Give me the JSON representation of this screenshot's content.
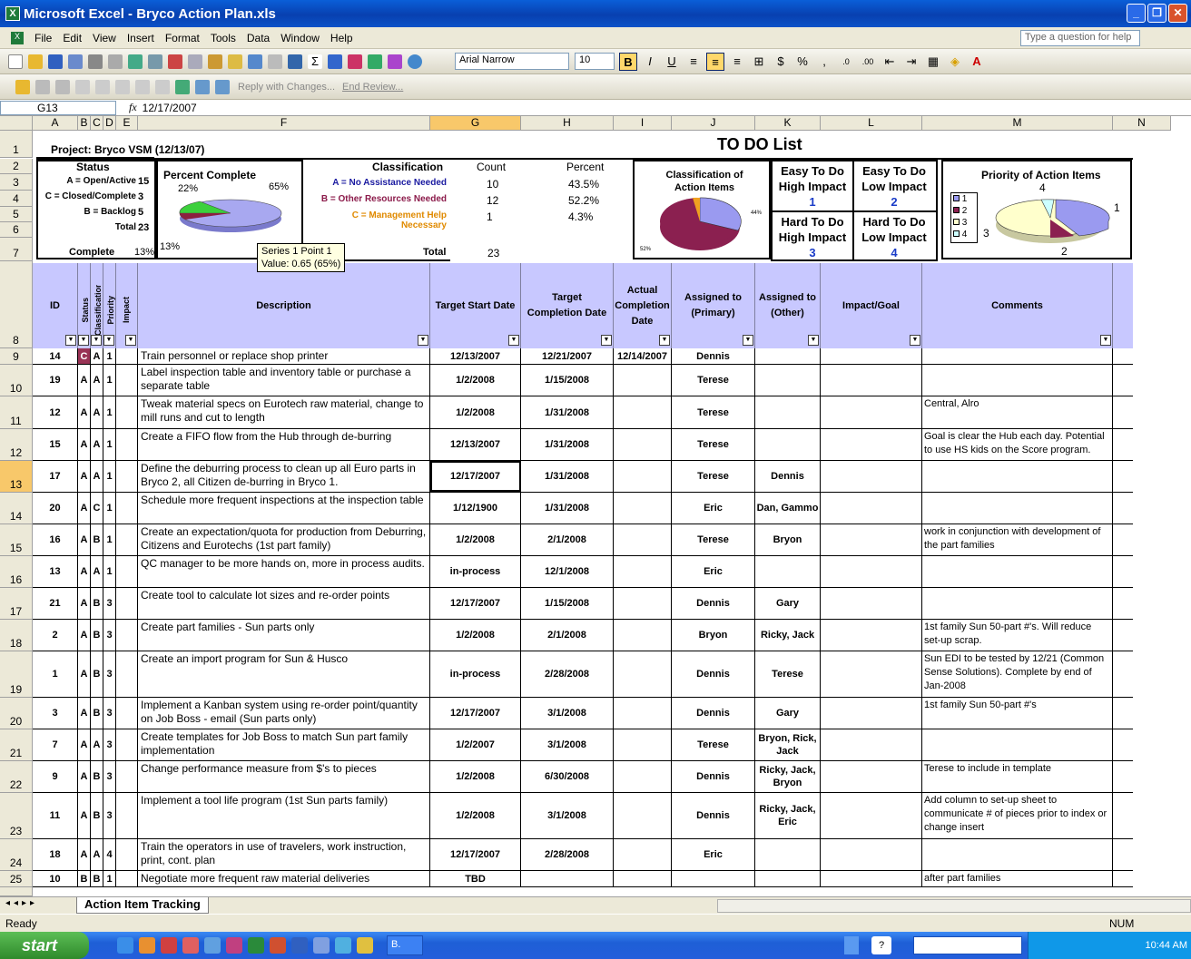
{
  "window": {
    "title": "Microsoft Excel - Bryco Action Plan.xls"
  },
  "menu": [
    "File",
    "Edit",
    "View",
    "Insert",
    "Format",
    "Tools",
    "Data",
    "Window",
    "Help"
  ],
  "help_placeholder": "Type a question for help",
  "toolbar": {
    "font": "Arial Narrow",
    "size": "10",
    "reply": "Reply with Changes...",
    "end_review": "End Review..."
  },
  "formula": {
    "cell": "G13",
    "value": "12/17/2007"
  },
  "columns": [
    {
      "letter": "A",
      "w": 50
    },
    {
      "letter": "B",
      "w": 14
    },
    {
      "letter": "C",
      "w": 14
    },
    {
      "letter": "D",
      "w": 14
    },
    {
      "letter": "E",
      "w": 24
    },
    {
      "letter": "F",
      "w": 322
    },
    {
      "letter": "G",
      "w": 100
    },
    {
      "letter": "H",
      "w": 102
    },
    {
      "letter": "I",
      "w": 64
    },
    {
      "letter": "J",
      "w": 92
    },
    {
      "letter": "K",
      "w": 72
    },
    {
      "letter": "L",
      "w": 112
    },
    {
      "letter": "M",
      "w": 210
    },
    {
      "letter": "N",
      "w": 64
    }
  ],
  "sheet": {
    "project": "Project:  Bryco VSM (12/13/07)",
    "todo": "TO DO List",
    "status_label": "Status",
    "status": [
      {
        "label": "A = Open/Active",
        "value": "15"
      },
      {
        "label": "C = Closed/Complete",
        "value": "3"
      },
      {
        "label": "B = Backlog",
        "value": "5"
      },
      {
        "label": "Total",
        "value": "23"
      }
    ],
    "complete_label": "Complete",
    "complete_value": "13%",
    "pc_chart": {
      "title": "Percent Complete",
      "lbl_a": "22%",
      "lbl_b": "65%",
      "lbl_c": "13%"
    },
    "classification_label": "Classification",
    "count_label": "Count",
    "percent_label": "Percent",
    "classes": [
      {
        "label": "A = No Assistance Needed",
        "count": "10",
        "percent": "43.5%",
        "color": "#1a1aa0"
      },
      {
        "label": "B = Other Resources Needed",
        "count": "12",
        "percent": "52.2%",
        "color": "#8b1a4a"
      },
      {
        "label": "C = Management Help Necessary",
        "count": "1",
        "percent": "4.3%",
        "color": "#e08a00"
      }
    ],
    "total_label": "Total",
    "total_value": "23",
    "class_chart": {
      "title": "Classification of Action Items",
      "lbl_a": "44%",
      "lbl_b": "52%"
    },
    "impact": [
      {
        "l1": "Easy To Do",
        "l2": "High Impact",
        "n": "1"
      },
      {
        "l1": "Easy To Do",
        "l2": "Low Impact",
        "n": "2"
      },
      {
        "l1": "Hard To Do",
        "l2": "High Impact",
        "n": "3"
      },
      {
        "l1": "Hard To Do",
        "l2": "Low Impact",
        "n": "4"
      }
    ],
    "priority_chart": {
      "title": "Priority of Action Items",
      "legend": [
        "1",
        "2",
        "3",
        "4"
      ],
      "labels": {
        "p1": "1",
        "p2": "2",
        "p3": "3",
        "p4": "4"
      }
    },
    "tooltip": {
      "l1": "Series 1 Point 1",
      "l2": "Value: 0.65 (65%)"
    },
    "headers": {
      "id": "ID",
      "status": "Status",
      "class": "Classification",
      "priority": "Priority",
      "e": "Impact",
      "desc": "Description",
      "start": "Target Start Date",
      "target": "Target Completion Date",
      "actual": "Actual Completion Date",
      "primary": "Assigned to (Primary)",
      "other": "Assigned to (Other)",
      "impact": "Impact/Goal",
      "comments": "Comments"
    },
    "rows": [
      {
        "r": "9",
        "id": "14",
        "s": "C",
        "c": "A",
        "p": "1",
        "desc": "Train personnel or replace shop printer",
        "start": "12/13/2007",
        "target": "12/21/2007",
        "actual": "12/14/2007",
        "prim": "Dennis",
        "other": "",
        "cmt": "",
        "h": 18
      },
      {
        "r": "10",
        "id": "19",
        "s": "A",
        "c": "A",
        "p": "1",
        "desc": "Label inspection table and inventory table or purchase a separate table",
        "start": "1/2/2008",
        "target": "1/15/2008",
        "actual": "",
        "prim": "Terese",
        "other": "",
        "cmt": "",
        "h": 35
      },
      {
        "r": "11",
        "id": "12",
        "s": "A",
        "c": "A",
        "p": "1",
        "desc": "Tweak material specs on Eurotech raw material, change to mill runs and cut to length",
        "start": "1/2/2008",
        "target": "1/31/2008",
        "actual": "",
        "prim": "Terese",
        "other": "",
        "cmt": "Central, Alro",
        "h": 36
      },
      {
        "r": "12",
        "id": "15",
        "s": "A",
        "c": "A",
        "p": "1",
        "desc": "Create a FIFO flow from the Hub through de-burring",
        "start": "12/13/2007",
        "target": "1/31/2008",
        "actual": "",
        "prim": "Terese",
        "other": "",
        "cmt": "Goal is clear the Hub each day. Potential to use HS kids on the Score program.",
        "h": 35
      },
      {
        "r": "13",
        "id": "17",
        "s": "A",
        "c": "A",
        "p": "1",
        "desc": "Define the deburring process to clean up all Euro parts in Bryco 2, all Citizen de-burring in Bryco 1.",
        "start": "12/17/2007",
        "target": "1/31/2008",
        "actual": "",
        "prim": "Terese",
        "other": "Dennis",
        "cmt": "",
        "h": 35
      },
      {
        "r": "14",
        "id": "20",
        "s": "A",
        "c": "C",
        "p": "1",
        "desc": "Schedule more frequent inspections at the inspection table",
        "start": "1/12/1900",
        "target": "1/31/2008",
        "actual": "",
        "prim": "Eric",
        "other": "Dan, Gammo",
        "cmt": "",
        "h": 35
      },
      {
        "r": "15",
        "id": "16",
        "s": "A",
        "c": "B",
        "p": "1",
        "desc": "Create an expectation/quota for production from Deburring, Citizens and Eurotechs (1st part family)",
        "start": "1/2/2008",
        "target": "2/1/2008",
        "actual": "",
        "prim": "Terese",
        "other": "Bryon",
        "cmt": "work in conjunction with development of the part families",
        "h": 35
      },
      {
        "r": "16",
        "id": "13",
        "s": "A",
        "c": "A",
        "p": "1",
        "desc": "QC manager to be more hands on, more in process audits.",
        "start": "in-process",
        "target": "12/1/2008",
        "actual": "",
        "prim": "Eric",
        "other": "",
        "cmt": "",
        "h": 35
      },
      {
        "r": "17",
        "id": "21",
        "s": "A",
        "c": "B",
        "p": "3",
        "desc": "Create tool to calculate lot sizes and re-order points",
        "start": "12/17/2007",
        "target": "1/15/2008",
        "actual": "",
        "prim": "Dennis",
        "other": "Gary",
        "cmt": "",
        "h": 35
      },
      {
        "r": "18",
        "id": "2",
        "s": "A",
        "c": "B",
        "p": "3",
        "desc": "Create part families - Sun parts only",
        "start": "1/2/2008",
        "target": "2/1/2008",
        "actual": "",
        "prim": "Bryon",
        "other": "Ricky, Jack",
        "cmt": "1st family Sun 50-part #'s. Will reduce set-up scrap.",
        "h": 35
      },
      {
        "r": "19",
        "id": "1",
        "s": "A",
        "c": "B",
        "p": "3",
        "desc": "Create an import program for Sun & Husco",
        "start": "in-process",
        "target": "2/28/2008",
        "actual": "",
        "prim": "Dennis",
        "other": "Terese",
        "cmt": "Sun EDI to be tested by 12/21 (Common Sense Solutions). Complete by end of Jan-2008",
        "h": 51
      },
      {
        "r": "20",
        "id": "3",
        "s": "A",
        "c": "B",
        "p": "3",
        "desc": "Implement a Kanban system using re-order point/quantity on Job Boss - email (Sun parts only)",
        "start": "12/17/2007",
        "target": "3/1/2008",
        "actual": "",
        "prim": "Dennis",
        "other": "Gary",
        "cmt": "1st family Sun 50-part #'s",
        "h": 35
      },
      {
        "r": "21",
        "id": "7",
        "s": "A",
        "c": "A",
        "p": "3",
        "desc": "Create templates for Job Boss to match Sun part family implementation",
        "start": "1/2/2007",
        "target": "3/1/2008",
        "actual": "",
        "prim": "Terese",
        "other": "Bryon, Rick, Jack",
        "cmt": "",
        "h": 35
      },
      {
        "r": "22",
        "id": "9",
        "s": "A",
        "c": "B",
        "p": "3",
        "desc": "Change performance measure from $'s to pieces",
        "start": "1/2/2008",
        "target": "6/30/2008",
        "actual": "",
        "prim": "Dennis",
        "other": "Ricky, Jack, Bryon",
        "cmt": "Terese to include in template",
        "h": 35
      },
      {
        "r": "23",
        "id": "11",
        "s": "A",
        "c": "B",
        "p": "3",
        "desc": "Implement a tool life program (1st Sun parts family)",
        "start": "1/2/2008",
        "target": "3/1/2008",
        "actual": "",
        "prim": "Dennis",
        "other": "Ricky, Jack, Eric",
        "cmt": "Add column to set-up sheet to communicate # of pieces prior to index or change insert",
        "h": 51
      },
      {
        "r": "24",
        "id": "18",
        "s": "A",
        "c": "A",
        "p": "4",
        "desc": "Train the operators in use of travelers, work instruction, print, cont. plan",
        "start": "12/17/2007",
        "target": "2/28/2008",
        "actual": "",
        "prim": "Eric",
        "other": "",
        "cmt": "",
        "h": 35
      },
      {
        "r": "25",
        "id": "10",
        "s": "B",
        "c": "B",
        "p": "1",
        "desc": "Negotiate more frequent raw material deliveries",
        "start": "TBD",
        "target": "",
        "actual": "",
        "prim": "",
        "other": "",
        "cmt": "after part families",
        "h": 18
      }
    ]
  },
  "tab": "Action Item Tracking",
  "status_bar": {
    "left": "Ready",
    "num": "NUM"
  },
  "taskbar": {
    "start": "start",
    "task": "B.",
    "clock": "10:44 AM"
  }
}
